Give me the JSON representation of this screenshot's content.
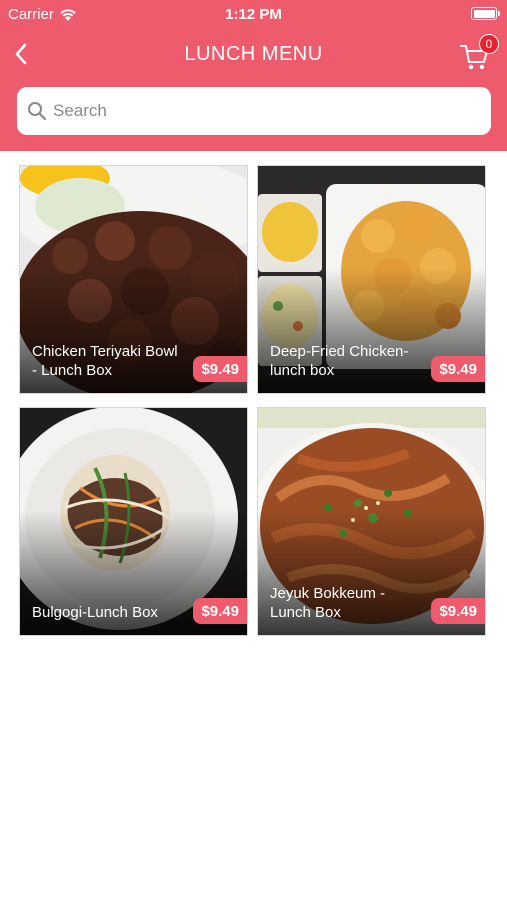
{
  "status_bar": {
    "carrier": "Carrier",
    "time": "1:12 PM"
  },
  "header": {
    "title": "LUNCH MENU",
    "cart_count": "0",
    "accent_color": "#ee5b6c"
  },
  "search": {
    "placeholder": "Search",
    "value": ""
  },
  "menu": {
    "items": [
      {
        "name": "Chicken Teriyaki Bowl - Lunch Box",
        "price": "$9.49"
      },
      {
        "name": "Deep-Fried Chicken-lunch box",
        "price": "$9.49"
      },
      {
        "name": "Bulgogi-Lunch Box",
        "price": "$9.49"
      },
      {
        "name": "Jeyuk Bokkeum - Lunch Box",
        "price": "$9.49"
      }
    ]
  }
}
